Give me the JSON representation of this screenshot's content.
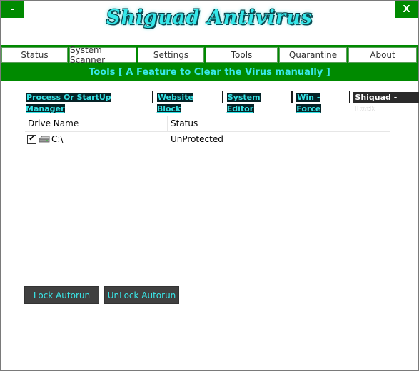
{
  "window": {
    "minimize_label": "-",
    "close_label": "X"
  },
  "app_title": "Shiguad Antivirus",
  "tabs": [
    {
      "label": "Status"
    },
    {
      "label": "System Scanner"
    },
    {
      "label": "Settings"
    },
    {
      "label": "Tools"
    },
    {
      "label": "Quarantine"
    },
    {
      "label": "About"
    }
  ],
  "subtitle": "Tools [ A Feature to Clear the Virus manually ]",
  "subtabs": [
    {
      "label": "Process Or StartUp Manager"
    },
    {
      "label": "Website Block"
    },
    {
      "label": "System Editor"
    },
    {
      "label": "Win - Force"
    },
    {
      "label": "Shiquad - Lock"
    }
  ],
  "grid": {
    "headers": [
      "Drive Name",
      "Status"
    ],
    "rows": [
      {
        "checked": true,
        "checkmark": "✔",
        "drive": "C:\\",
        "status": "UnProtected"
      }
    ]
  },
  "buttons": {
    "lock": "Lock Autorun",
    "unlock": "UnLock Autorun"
  },
  "colors": {
    "green": "#008a00",
    "cyan": "#39e7e9",
    "dark_button": "#404040"
  },
  "icons": {
    "drive": "drive-icon"
  }
}
